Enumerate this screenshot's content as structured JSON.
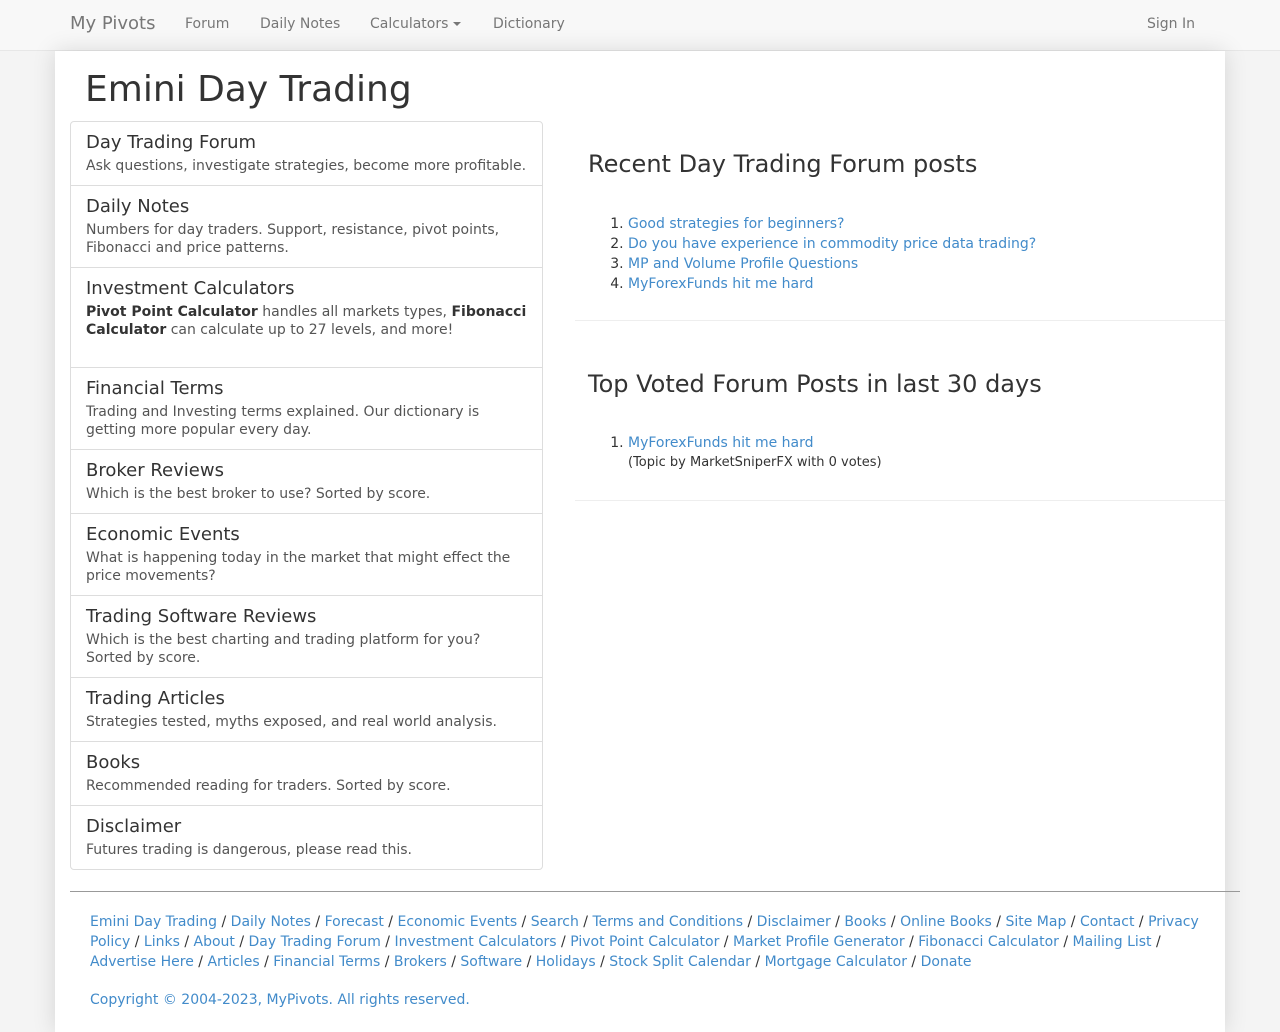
{
  "navbar": {
    "brand": "My Pivots",
    "links": [
      "Forum",
      "Daily Notes",
      "Calculators",
      "Dictionary"
    ],
    "sign_in": "Sign In"
  },
  "page": {
    "title": "Emini Day Trading"
  },
  "list": [
    {
      "title": "Day Trading Forum",
      "text": "Ask questions, investigate strategies, become more profitable."
    },
    {
      "title": "Daily Notes",
      "text": "Numbers for day traders. Support, resistance, pivot points, Fibonacci and price patterns."
    },
    {
      "title": "Investment Calculators",
      "bold1": "Pivot Point Calculator",
      "text1": " handles all markets types, ",
      "bold2": "Fibonacci Calculator",
      "text2": " can calculate up to 27 levels, and more!"
    },
    {
      "title": "Financial Terms",
      "text": "Trading and Investing terms explained. Our dictionary is getting more popular every day."
    },
    {
      "title": "Broker Reviews",
      "text": "Which is the best broker to use? Sorted by score."
    },
    {
      "title": "Economic Events",
      "text": "What is happening today in the market that might effect the price movements?"
    },
    {
      "title": "Trading Software Reviews",
      "text": "Which is the best charting and trading platform for you? Sorted by score."
    },
    {
      "title": "Trading Articles",
      "text": "Strategies tested, myths exposed, and real world analysis."
    },
    {
      "title": "Books",
      "text": "Recommended reading for traders. Sorted by score."
    },
    {
      "title": "Disclaimer",
      "text": "Futures trading is dangerous, please read this."
    }
  ],
  "recent": {
    "title": "Recent Day Trading Forum posts",
    "posts": [
      "Good strategies for beginners?",
      "Do you have experience in commodity price data trading?",
      "MP and Volume Profile Questions",
      "MyForexFunds hit me hard"
    ]
  },
  "top_voted": {
    "title": "Top Voted Forum Posts in last 30 days",
    "posts": [
      {
        "title": "MyForexFunds hit me hard",
        "note": "(Topic by MarketSniperFX with 0 votes)"
      }
    ]
  },
  "footer": {
    "links": [
      "Emini Day Trading",
      "Daily Notes",
      "Forecast",
      "Economic Events",
      "Search",
      "Terms and Conditions",
      "Disclaimer",
      "Books",
      "Online Books",
      "Site Map",
      "Contact",
      "Privacy Policy",
      "Links",
      "About",
      "Day Trading Forum",
      "Investment Calculators",
      "Pivot Point Calculator",
      "Market Profile Generator",
      "Fibonacci Calculator",
      "Mailing List",
      "Advertise Here",
      "Articles",
      "Financial Terms",
      "Brokers",
      "Software",
      "Holidays",
      "Stock Split Calendar",
      "Mortgage Calculator",
      "Donate"
    ],
    "separator": " / ",
    "copyright": "Copyright © 2004-2023, MyPivots. All rights reserved."
  },
  "colors": {
    "link": "#428bca",
    "nav_bg": "#f8f8f8",
    "nav_text": "#777777"
  }
}
